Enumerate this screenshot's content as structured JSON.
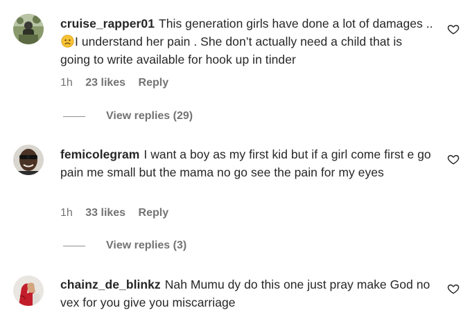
{
  "comments": [
    {
      "username": "cruise_rapper01",
      "text_before_emoji": "This generation girls have done a lot of damages ..",
      "emoji": "sad-face",
      "text_after_emoji": "I understand her pain . She don’t actually need a child that is going to write available for hook up in tinder",
      "time": "1h",
      "likes": "23 likes",
      "reply_label": "Reply",
      "view_replies": "View replies (29)"
    },
    {
      "username": "femicolegram",
      "text": "I want a boy as my first kid but if a girl come first e go pain me small but the mama no go see the pain for my eyes",
      "time": "1h",
      "likes": "33 likes",
      "reply_label": "Reply",
      "view_replies": "View replies (3)"
    },
    {
      "username": "chainz_de_blinkz",
      "text": "Nah Mumu dy do this one just pray make God no vex for you give you miscarriage"
    }
  ],
  "icons": {
    "like": "heart-outline-icon"
  },
  "colors": {
    "text": "#262626",
    "secondary": "#737373",
    "background": "#ffffff"
  }
}
